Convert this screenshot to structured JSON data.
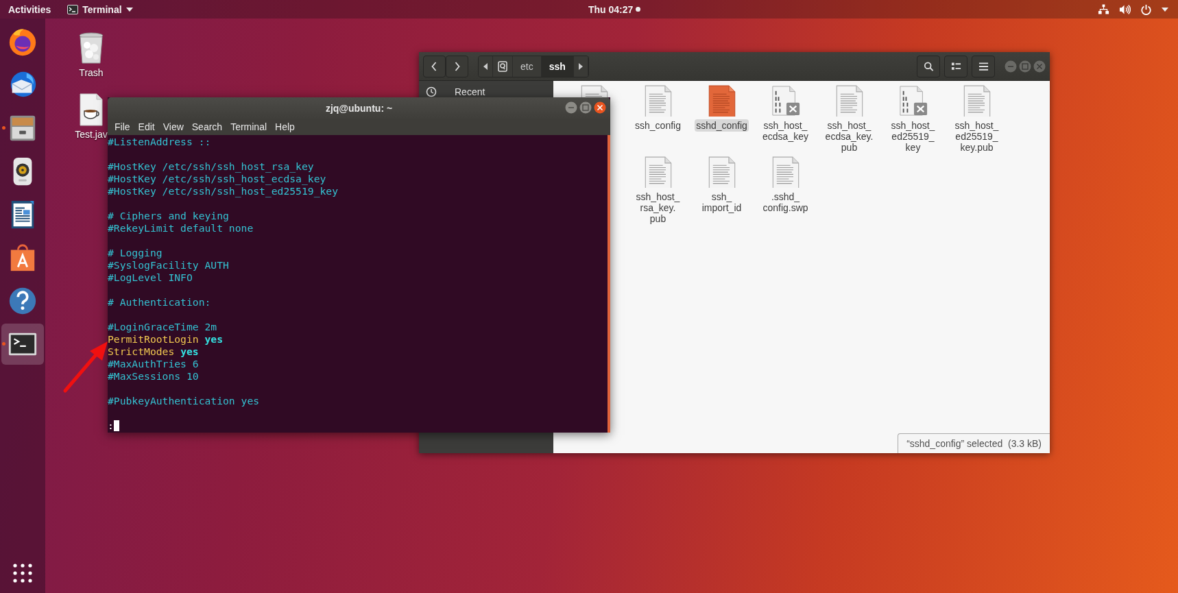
{
  "top_bar": {
    "activities": "Activities",
    "app_menu": {
      "label": "Terminal"
    },
    "clock": "Thu 04:27",
    "notification": true
  },
  "dock": {
    "items": [
      {
        "kind": "browser",
        "running": false,
        "selected": false
      },
      {
        "kind": "mail",
        "running": false,
        "selected": false
      },
      {
        "kind": "files",
        "running": true,
        "selected": false
      },
      {
        "kind": "music",
        "running": false,
        "selected": false
      },
      {
        "kind": "writer",
        "running": false,
        "selected": false
      },
      {
        "kind": "software",
        "running": false,
        "selected": false
      },
      {
        "kind": "help",
        "running": false,
        "selected": false
      },
      {
        "kind": "terminal",
        "running": true,
        "selected": true
      }
    ]
  },
  "desktop_icons": [
    {
      "kind": "trash",
      "label": "Trash"
    },
    {
      "kind": "java",
      "label": "Test.jav"
    }
  ],
  "file_manager": {
    "path": [
      {
        "label": "etc",
        "selected": false
      },
      {
        "label": "ssh",
        "selected": true
      }
    ],
    "sidebar": [
      {
        "label": "Recent"
      }
    ],
    "rows": [
      {
        "items": [
          {
            "kind": "text",
            "selected": false
          },
          {
            "kind": "text",
            "label": "ssh_config",
            "selected": false
          },
          {
            "kind": "text",
            "label": "sshd_config",
            "selected": true
          },
          {
            "kind": "binary",
            "label": "ssh_host_ ecdsa_key",
            "selected": false
          },
          {
            "kind": "text",
            "label": "ssh_host_ ecdsa_key. pub",
            "selected": false
          },
          {
            "kind": "binary",
            "label": "ssh_host_ ed25519_ key",
            "selected": false
          },
          {
            "kind": "text",
            "label": "ssh_host_ ed25519_ key.pub",
            "selected": false
          }
        ]
      },
      {
        "items": [
          {
            "kind": "text",
            "label": "ssh_host_ rsa_key. pub",
            "selected": false
          },
          {
            "kind": "text",
            "label": "ssh_ import_id",
            "selected": false
          },
          {
            "kind": "text",
            "label": ".sshd_ config.swp",
            "selected": false
          }
        ]
      }
    ],
    "status": "“sshd_config” selected  (3.3 kB)"
  },
  "terminal": {
    "title": "zjq@ubuntu: ~",
    "menus": [
      "File",
      "Edit",
      "View",
      "Search",
      "Terminal",
      "Help"
    ],
    "lines": [
      {
        "kind": "comment",
        "text": "#ListenAddress ::"
      },
      {
        "kind": "blank"
      },
      {
        "kind": "comment",
        "text": "#HostKey /etc/ssh/ssh_host_rsa_key"
      },
      {
        "kind": "comment",
        "text": "#HostKey /etc/ssh/ssh_host_ecdsa_key"
      },
      {
        "kind": "comment",
        "text": "#HostKey /etc/ssh/ssh_host_ed25519_key"
      },
      {
        "kind": "blank"
      },
      {
        "kind": "comment",
        "text": "# Ciphers and keying"
      },
      {
        "kind": "comment",
        "text": "#RekeyLimit default none"
      },
      {
        "kind": "blank"
      },
      {
        "kind": "comment",
        "text": "# Logging"
      },
      {
        "kind": "comment",
        "text": "#SyslogFacility AUTH"
      },
      {
        "kind": "comment",
        "text": "#LogLevel INFO"
      },
      {
        "kind": "blank"
      },
      {
        "kind": "comment",
        "text": "# Authentication:"
      },
      {
        "kind": "blank"
      },
      {
        "kind": "comment",
        "text": "#LoginGraceTime 2m"
      },
      {
        "kind": "directive",
        "key": "PermitRootLogin",
        "value": "yes"
      },
      {
        "kind": "directive",
        "key": "StrictModes",
        "value": "yes"
      },
      {
        "kind": "comment",
        "text": "#MaxAuthTries 6"
      },
      {
        "kind": "comment",
        "text": "#MaxSessions 10"
      },
      {
        "kind": "blank"
      },
      {
        "kind": "comment",
        "text": "#PubkeyAuthentication yes"
      },
      {
        "kind": "blank"
      },
      {
        "kind": "prompt",
        "text": ":"
      }
    ]
  }
}
